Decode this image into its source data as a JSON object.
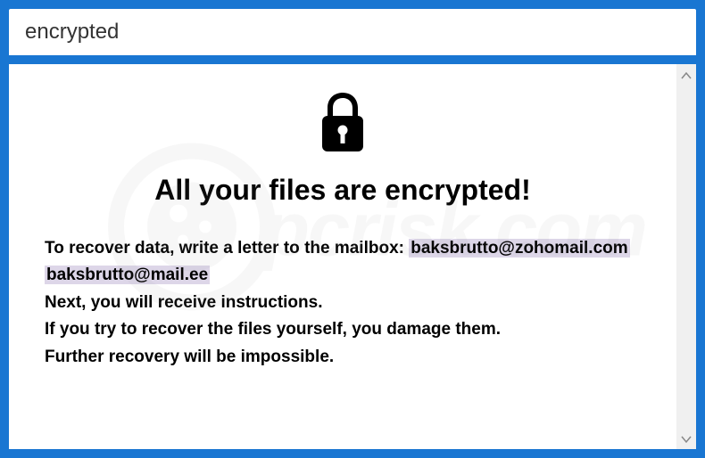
{
  "window": {
    "title": "encrypted"
  },
  "content": {
    "heading": "All your files are encrypted!",
    "line1_prefix": "To recover data, write a letter to the mailbox: ",
    "email1": "baksbrutto@zohomail.com",
    "email2": "baksbrutto@mail.ee",
    "line2": "Next, you will receive instructions.",
    "line3": "If you try to recover the files yourself, you damage them.",
    "line4": "Further recovery will be impossible."
  },
  "watermark": {
    "text": "pcrisk.com"
  }
}
